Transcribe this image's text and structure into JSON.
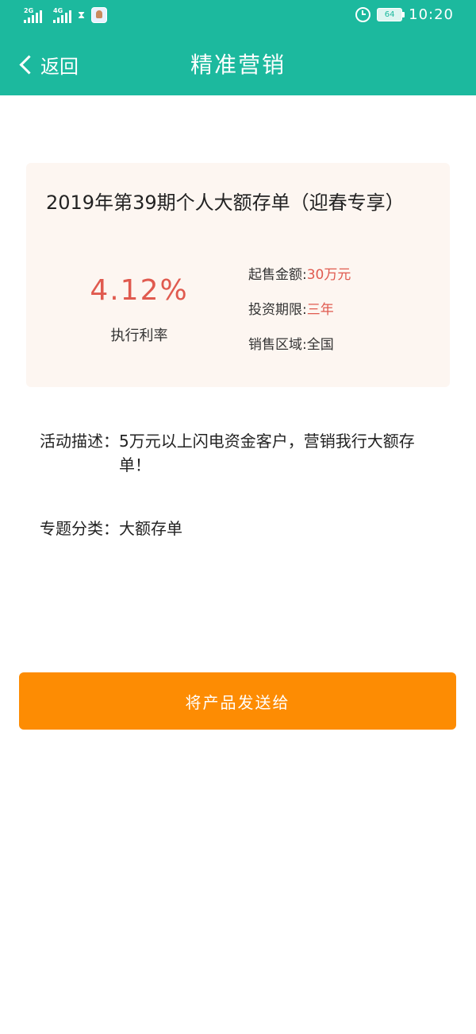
{
  "status_bar": {
    "network_1": "2G",
    "network_2": "4G",
    "battery": "64",
    "time": "10:20"
  },
  "header": {
    "back_label": "返回",
    "title": "精准营销"
  },
  "product": {
    "name": "2019年第39期个人大额存单（迎春专享）",
    "rate": "4.12%",
    "rate_label": "执行利率",
    "min_amount_label": "起售金额:",
    "min_amount_value": "30万元",
    "term_label": "投资期限:",
    "term_value": "三年",
    "region_label": "销售区域:",
    "region_value": "全国"
  },
  "activity": {
    "label": "活动描述：",
    "text": "5万元以上闪电资金客户，营销我行大额存单！"
  },
  "topic": {
    "label": "专题分类：",
    "value": "大额存单"
  },
  "action": {
    "send_label": "将产品发送给"
  },
  "colors": {
    "header": "#1cb99e",
    "card_bg": "#fdf6f1",
    "accent_red": "#e05a4f",
    "button": "#fd8c03"
  }
}
